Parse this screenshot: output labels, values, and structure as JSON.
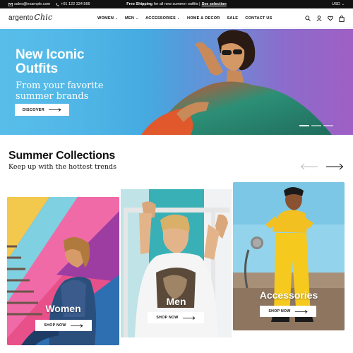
{
  "topbar": {
    "email": "sales@example.com",
    "phone": "+01 122 334 566",
    "promo_bold": "Free Shipping",
    "promo_text": "for all new summer outfits |",
    "promo_link": "See selection",
    "currency": "USD"
  },
  "header": {
    "logo_part1": "argento",
    "logo_part2": "Chic",
    "nav": [
      {
        "label": "WOMEN",
        "dropdown": true
      },
      {
        "label": "MEN",
        "dropdown": true
      },
      {
        "label": "ACCESSORIES",
        "dropdown": true
      },
      {
        "label": "HOME & DECOR",
        "dropdown": false
      },
      {
        "label": "SALE",
        "dropdown": false
      },
      {
        "label": "CONTACT US",
        "dropdown": false
      }
    ],
    "icons": [
      "search-icon",
      "user-icon",
      "heart-icon",
      "cart-icon"
    ]
  },
  "hero": {
    "title_line1": "New Iconic",
    "title_line2": "Outfits",
    "subtitle_line1": "From your favorite",
    "subtitle_line2": "summer brands",
    "button_label": "DISCOVER",
    "slides": 3,
    "active_slide": 1
  },
  "collections": {
    "title": "Summer Collections",
    "subtitle": "Keep up with the hottest trends",
    "cards": [
      {
        "label": "Women",
        "button": "SHOP NOW"
      },
      {
        "label": "Men",
        "button": "SHOP NOW"
      },
      {
        "label": "Accessories",
        "button": "SHOP NOW"
      }
    ]
  },
  "colors": {
    "topbar_bg": "#111111",
    "hero_blue": "#4fb4e6",
    "hero_purple": "#a05fc4",
    "text": "#111111"
  }
}
